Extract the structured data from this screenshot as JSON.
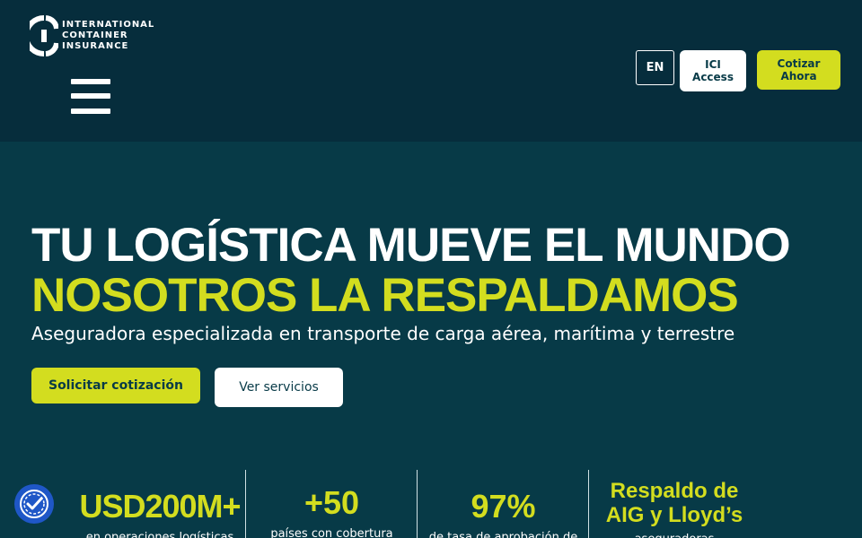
{
  "brand": {
    "logo_lines": [
      "INTERNATIONAL",
      "CONTAINER",
      "INSURANCE"
    ],
    "accent_color": "#d3dd1f",
    "header_color": "#062d3c",
    "hero_color": "#073a47"
  },
  "header": {
    "menu_icon": "hamburger-icon",
    "lang_label": "EN",
    "access_label": "ICI Access",
    "quote_label": "Cotizar Ahora"
  },
  "hero": {
    "title_line1": "TU LOGÍSTICA MUEVE EL MUNDO",
    "title_line2": "NOSOTROS LA RESPALDAMOS",
    "subtitle": "Aseguradora especializada en transporte de carga aérea, marítima y terrestre",
    "primary_cta": "Solicitar cotización",
    "secondary_cta": "Ver servicios"
  },
  "stats": [
    {
      "value": "USD200M+",
      "label": "en operaciones logísticas"
    },
    {
      "value": "+50",
      "label": "países con cobertura"
    },
    {
      "value": "97%",
      "label": "de tasa de aprobación de"
    },
    {
      "value": "Respaldo de AIG y Lloyd’s",
      "label": "aseguradoras"
    }
  ],
  "accessibility": {
    "icon": "accessibility-icon"
  }
}
